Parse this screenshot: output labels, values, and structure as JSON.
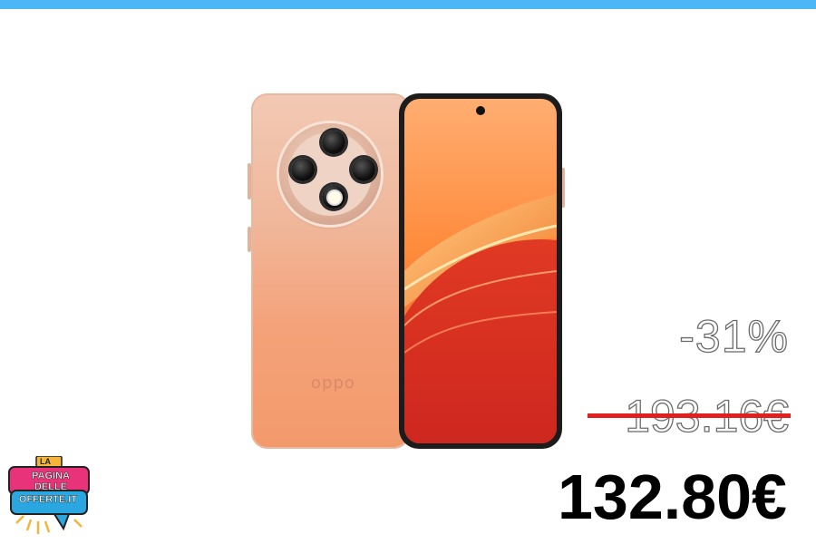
{
  "product": {
    "brand_logo": "oppo",
    "image_alt": "Oppo smartphone front and back"
  },
  "price": {
    "discount": "-31%",
    "old_price": "193.16€",
    "new_price": "132.80€"
  },
  "badge": {
    "la": "LA",
    "line1": "PAGINA DELLE",
    "line2": "OFFERTE.IT"
  },
  "colors": {
    "top_bar": "#4db7f5",
    "strike": "#e0201f",
    "badge_pink": "#e8327a",
    "badge_blue": "#2aa7e0"
  }
}
